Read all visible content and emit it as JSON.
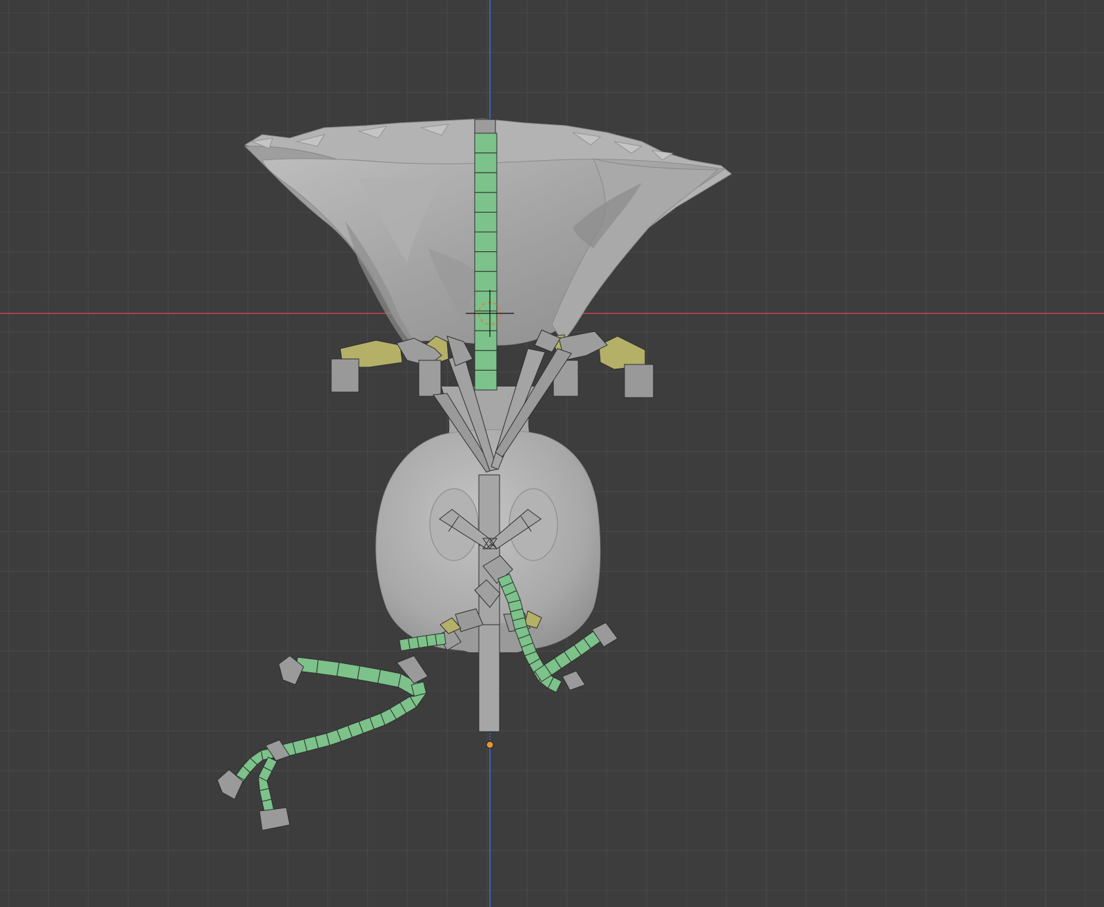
{
  "viewport": {
    "mode": "3d-viewport",
    "background_color": "#3d3d3d",
    "grid_color": "#4a4a4a",
    "x_axis_color": "#c8464e",
    "z_axis_color": "#3a6fd6"
  },
  "scene": {
    "mesh_color": "#a6a6a6",
    "bone_gray_color": "#8c8c8c",
    "bone_selected_color": "#7cc28a",
    "bone_yellow_color": "#b4b068",
    "origin_dot_color": "#e6953a",
    "objects": [
      "flower-mesh",
      "armature"
    ]
  }
}
